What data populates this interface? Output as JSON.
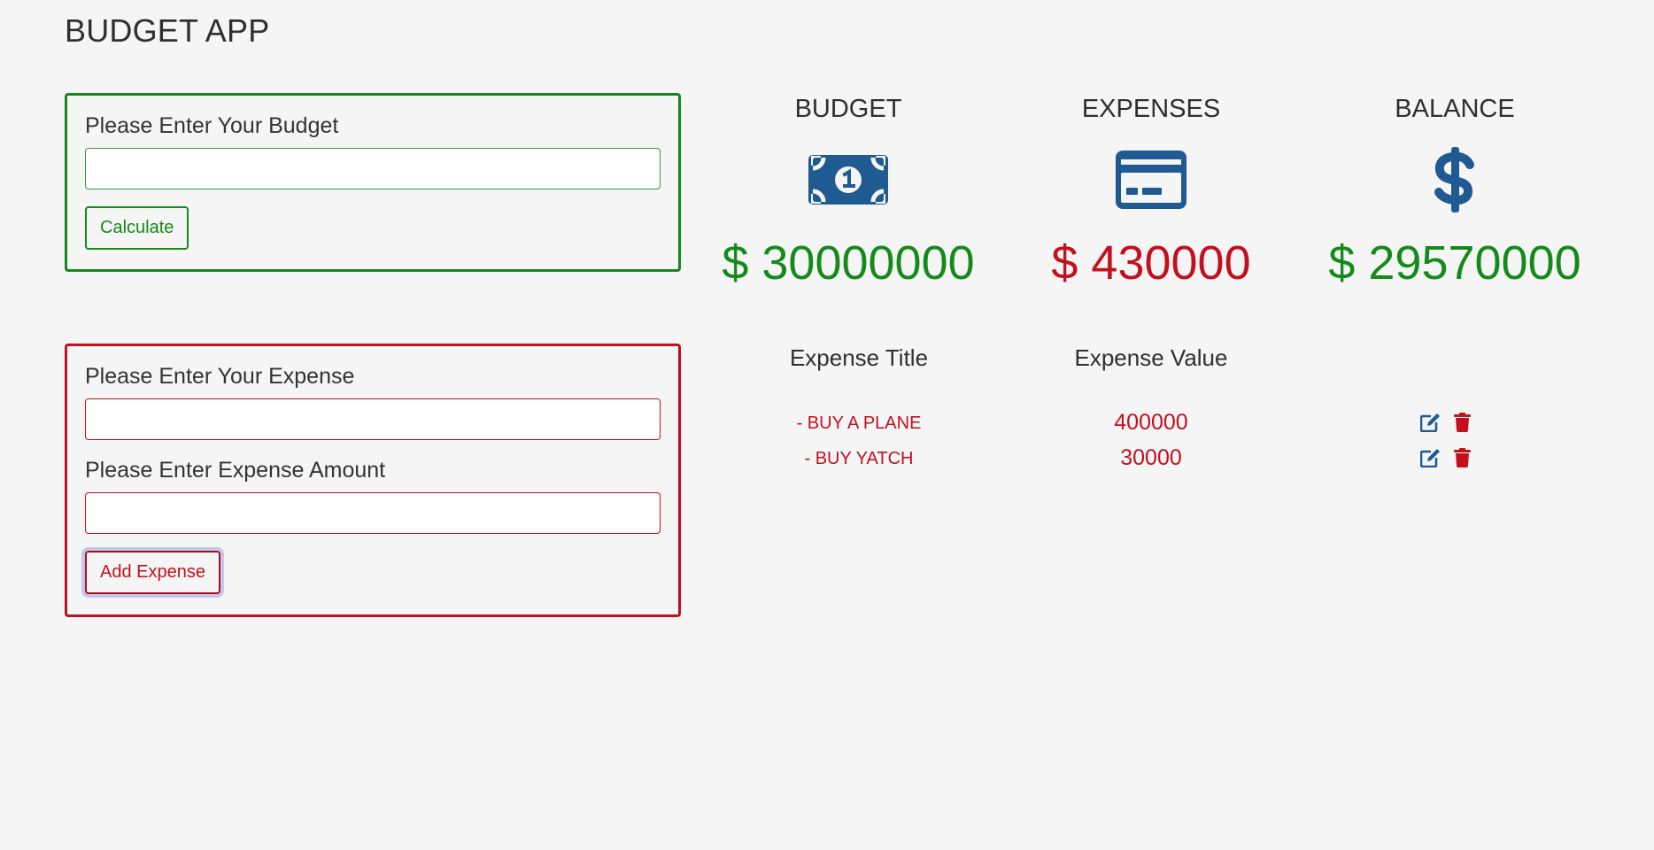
{
  "app": {
    "title": "BUDGET APP"
  },
  "budget_form": {
    "label": "Please Enter Your Budget",
    "input_value": "",
    "button_label": "Calculate"
  },
  "expense_form": {
    "title_label": "Please Enter Your Expense",
    "title_value": "",
    "amount_label": "Please Enter Expense Amount",
    "amount_value": "",
    "button_label": "Add Expense"
  },
  "summary": {
    "budget": {
      "heading": "BUDGET",
      "icon": "money-bill-icon",
      "amount": "$ 30000000"
    },
    "expenses": {
      "heading": "EXPENSES",
      "icon": "credit-card-icon",
      "amount": "$ 430000"
    },
    "balance": {
      "heading": "BALANCE",
      "icon": "dollar-sign-icon",
      "amount": "$ 29570000"
    }
  },
  "expense_list": {
    "title_header": "Expense Title",
    "value_header": "Expense Value",
    "items": [
      {
        "title": "- BUY A PLANE",
        "value": "400000"
      },
      {
        "title": "- BUY YATCH",
        "value": "30000"
      }
    ]
  },
  "colors": {
    "positive": "#138a1a",
    "negative": "#c2101e",
    "icon": "#1f5a92",
    "background": "#f5f5f5"
  }
}
